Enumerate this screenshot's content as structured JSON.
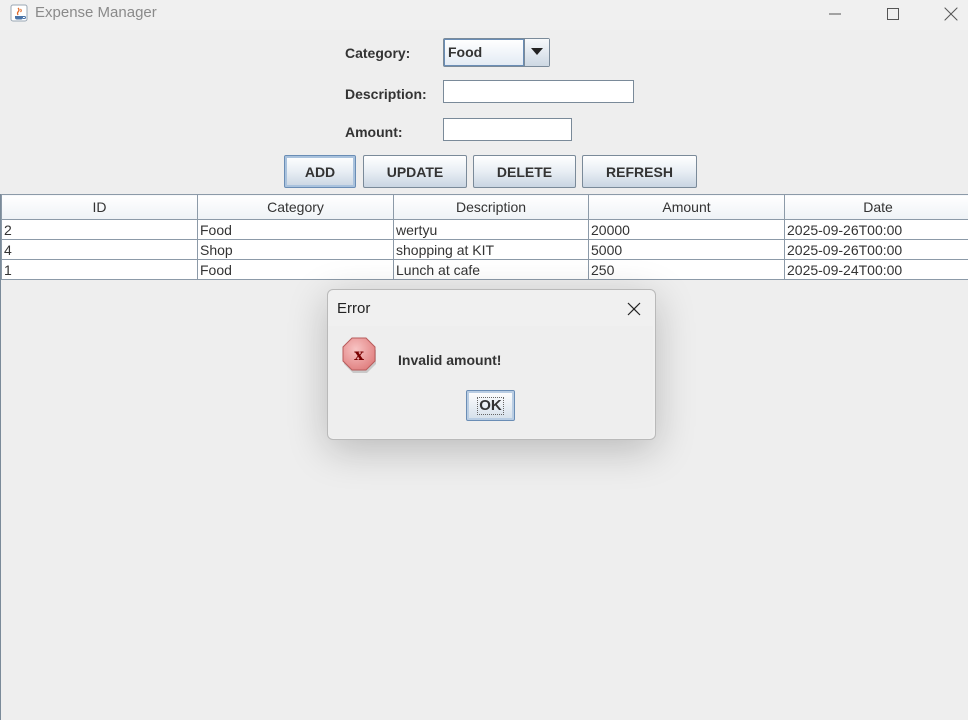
{
  "window": {
    "title": "Expense Manager",
    "controls": [
      "minimize-icon",
      "maximize-icon",
      "close-icon"
    ]
  },
  "form": {
    "category_label": "Category:",
    "category_value": "Food",
    "description_label": "Description:",
    "description_value": "",
    "amount_label": "Amount:",
    "amount_value": ""
  },
  "buttons": {
    "add": "ADD",
    "update": "UPDATE",
    "delete": "DELETE",
    "refresh": "REFRESH"
  },
  "table": {
    "columns": [
      "ID",
      "Category",
      "Description",
      "Amount",
      "Date"
    ],
    "rows": [
      [
        "2",
        "Food",
        "wertyu",
        "20000",
        "2025-09-26T00:00"
      ],
      [
        "4",
        "Shop",
        "shopping at KIT",
        "5000",
        "2025-09-26T00:00"
      ],
      [
        "1",
        "Food",
        "Lunch at cafe",
        "250",
        "2025-09-24T00:00"
      ]
    ]
  },
  "dialog": {
    "title": "Error",
    "message": "Invalid amount!",
    "ok_label": "OK",
    "icon": "error-icon"
  }
}
